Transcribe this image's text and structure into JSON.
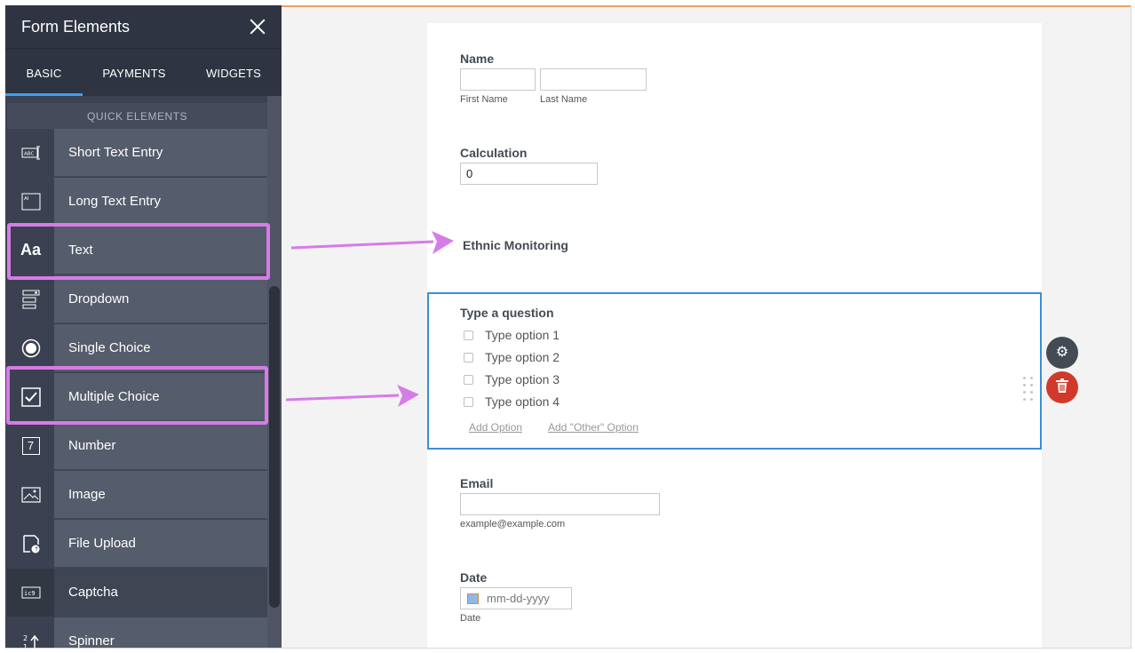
{
  "sidebar": {
    "title": "Form Elements",
    "tabs": [
      "BASIC",
      "PAYMENTS",
      "WIDGETS"
    ],
    "active_tab": "BASIC",
    "section_label": "QUICK ELEMENTS",
    "items": [
      {
        "label": "Short Text Entry",
        "icon": "short-text-icon"
      },
      {
        "label": "Long Text Entry",
        "icon": "long-text-icon"
      },
      {
        "label": "Text",
        "icon": "text-icon",
        "icon_text": "Aa"
      },
      {
        "label": "Dropdown",
        "icon": "dropdown-icon"
      },
      {
        "label": "Single Choice",
        "icon": "radio-icon"
      },
      {
        "label": "Multiple Choice",
        "icon": "checkbox-icon"
      },
      {
        "label": "Number",
        "icon": "number-icon",
        "icon_text": "7"
      },
      {
        "label": "Image",
        "icon": "image-icon"
      },
      {
        "label": "File Upload",
        "icon": "file-upload-icon"
      },
      {
        "label": "Captcha",
        "icon": "captcha-icon"
      },
      {
        "label": "Spinner",
        "icon": "spinner-icon"
      }
    ]
  },
  "form": {
    "name": {
      "label": "Name",
      "first_sub": "First Name",
      "last_sub": "Last Name"
    },
    "calculation": {
      "label": "Calculation",
      "value": "0"
    },
    "heading": "Ethnic Monitoring",
    "question": {
      "label": "Type a question",
      "options": [
        "Type option 1",
        "Type option 2",
        "Type option 3",
        "Type option 4"
      ],
      "add_option": "Add Option",
      "add_other": "Add \"Other\" Option"
    },
    "email": {
      "label": "Email",
      "sub": "example@example.com"
    },
    "date": {
      "label": "Date",
      "placeholder": "mm-dd-yyyy",
      "sub": "Date"
    }
  },
  "colors": {
    "highlight": "#d77be8",
    "selection_border": "#3b8fd6",
    "delete_button": "#d1392b",
    "settings_button": "#444b55",
    "tab_indicator": "#3aa0ff"
  }
}
